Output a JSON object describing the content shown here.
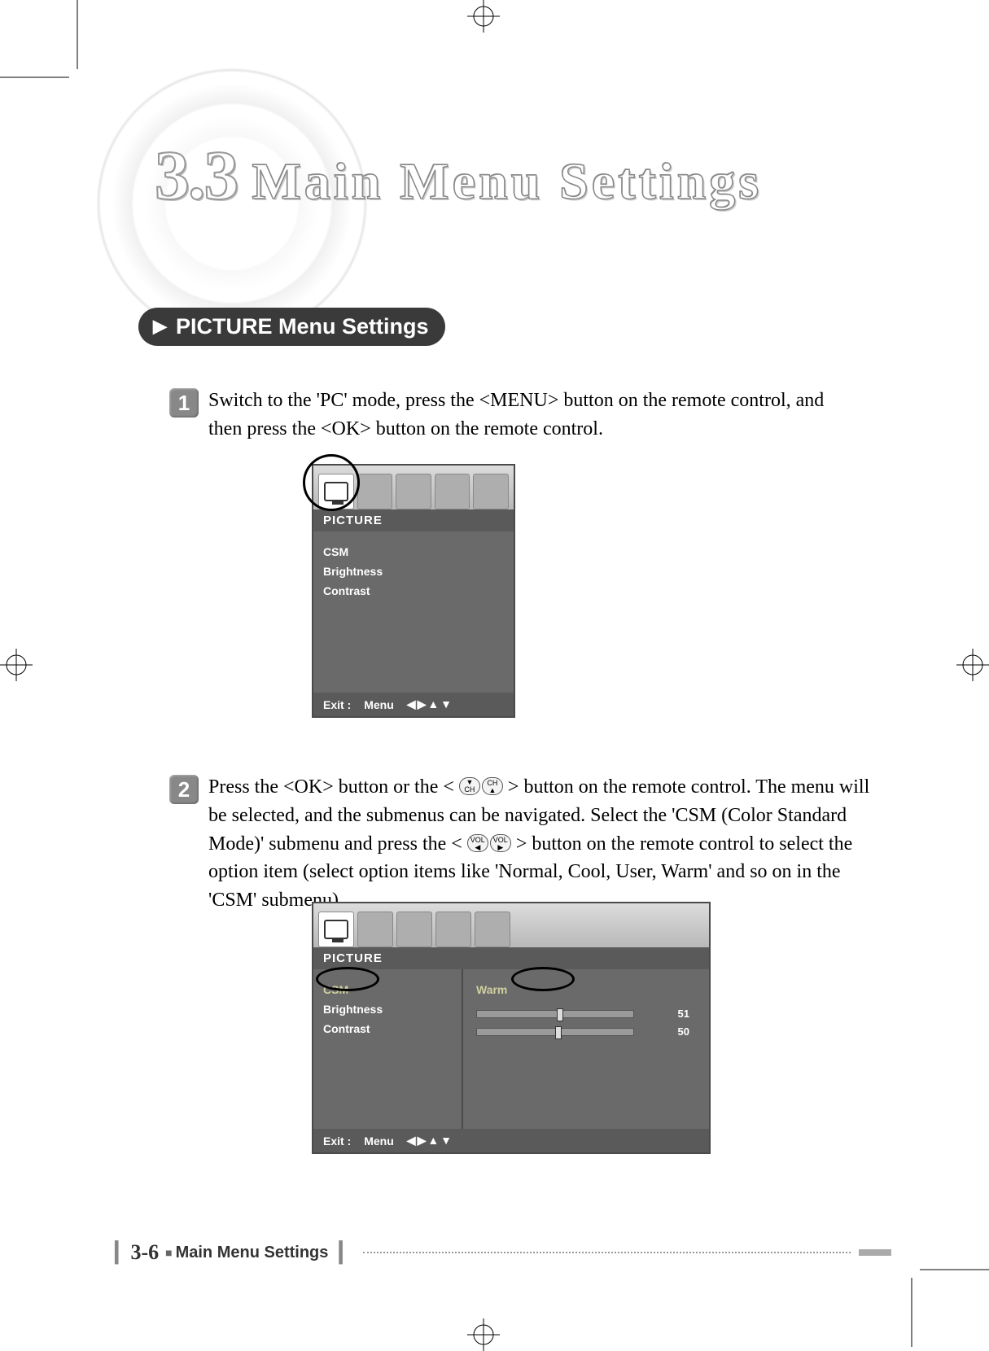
{
  "section_number": "3.3",
  "section_title": "Main Menu Settings",
  "subsection_heading": "PICTURE Menu Settings",
  "steps": [
    {
      "num": "1",
      "text": "Switch to the 'PC' mode, press the <MENU> button on the remote control, and then press the <OK> button on the remote control."
    },
    {
      "num": "2",
      "text_a": "Press the <OK> button or the <",
      "text_b": "> button on the remote control. The menu will be selected, and the submenus can be navigated. Select the 'CSM (Color Standard Mode)' submenu and press the <",
      "text_c": "> button on the remote control to select the option item (select option items like 'Normal, Cool, User, Warm' and so on in the 'CSM' submenu)."
    }
  ],
  "osd1": {
    "title": "PICTURE",
    "items": [
      "CSM",
      "Brightness",
      "Contrast"
    ],
    "footer_exit": "Exit :",
    "footer_menu": "Menu",
    "footer_arrows": "◀▶▲▼"
  },
  "osd2": {
    "title": "PICTURE",
    "items": [
      "CSM",
      "Brightness",
      "Contrast"
    ],
    "selected": "CSM",
    "csm_value": "Warm",
    "brightness": 51,
    "contrast": 50,
    "footer_exit": "Exit :",
    "footer_menu": "Menu",
    "footer_arrows": "◀▶▲▼"
  },
  "remote_buttons": {
    "ch_down": "CH",
    "ch_up": "CH",
    "vol_left": "VOL",
    "vol_right": "VOL"
  },
  "footer": {
    "page": "3-6",
    "title": "Main Menu Settings"
  }
}
